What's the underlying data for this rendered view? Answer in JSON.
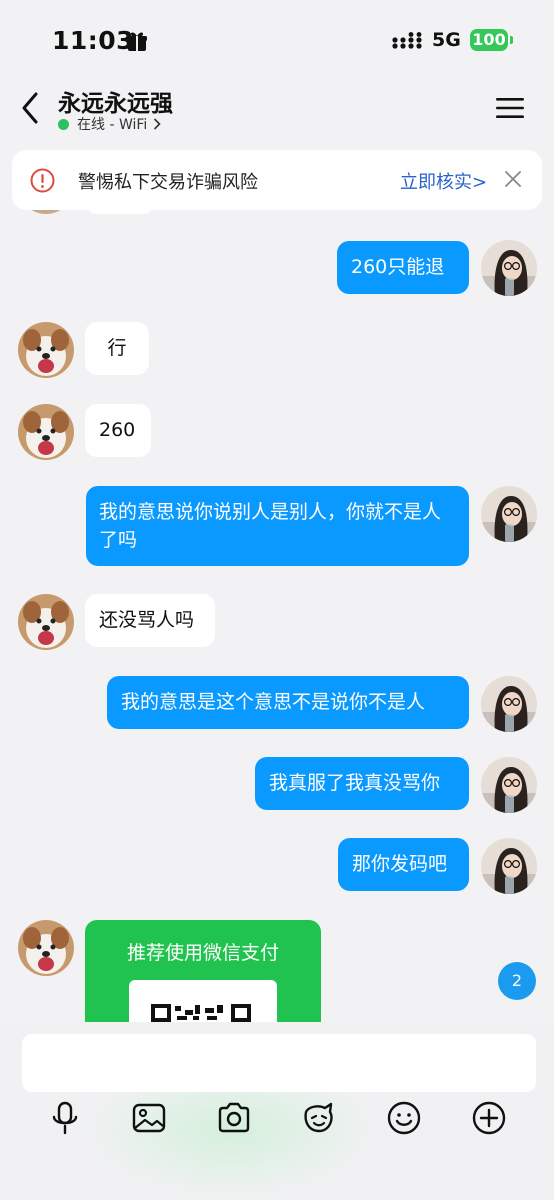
{
  "status_bar": {
    "time": "11:03",
    "network": "5G",
    "battery": "100"
  },
  "header": {
    "contact_name": "永远永远强",
    "online_status": "在线 - WiFi"
  },
  "warning": {
    "text": "警惕私下交易诈骗风险",
    "action": "立即核实>"
  },
  "messages": [
    {
      "side": "out",
      "text": "260只能退"
    },
    {
      "side": "in",
      "text": "行"
    },
    {
      "side": "in",
      "text": "260"
    },
    {
      "side": "out",
      "text": "我的意思说你说别人是别人，你就不是人了吗"
    },
    {
      "side": "in",
      "text": "还没骂人吗"
    },
    {
      "side": "out",
      "text": "我的意思是这个意思不是说你不是人"
    },
    {
      "side": "out",
      "text": "我真服了我真没骂你"
    },
    {
      "side": "out",
      "text": "那你发码吧"
    }
  ],
  "pay_card": {
    "title": "推荐使用微信支付"
  },
  "unread_count": "2",
  "colors": {
    "outgoing_bubble": "#0a99ff",
    "incoming_bubble": "#ffffff",
    "pay_card": "#20c34f",
    "online_dot": "#2bc25e",
    "link": "#2a62c9"
  },
  "toolbar": {
    "icons": [
      "microphone-icon",
      "image-icon",
      "camera-icon",
      "sticker-icon",
      "emoji-icon",
      "plus-icon"
    ]
  }
}
